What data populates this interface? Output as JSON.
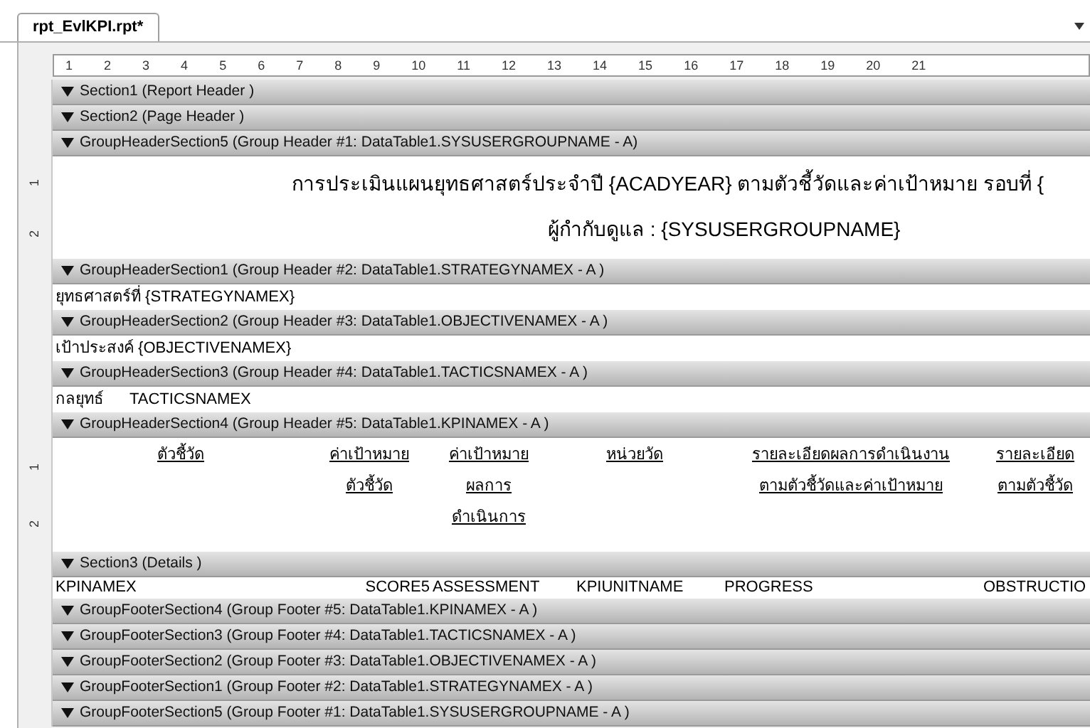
{
  "tab": {
    "label": "rpt_EvlKPI.rpt*",
    "selected": true
  },
  "ruler": {
    "marks": [
      "1",
      "2",
      "3",
      "4",
      "5",
      "6",
      "7",
      "8",
      "9",
      "10",
      "11",
      "12",
      "13",
      "14",
      "15",
      "16",
      "17",
      "18",
      "19",
      "20",
      "21"
    ]
  },
  "sections": [
    {
      "name": "Section1 (Report Header )",
      "expanded": true
    },
    {
      "name": "Section2 (Page Header )",
      "expanded": true
    },
    {
      "name": "GroupHeaderSection5 (Group Header #1: DataTable1.SYSUSERGROUPNAME - A)",
      "expanded": true,
      "body": {
        "kind": "title",
        "ruler_labels": [
          "1",
          "2"
        ],
        "lines": [
          "การประเมินแผนยุทธศาสตร์ประจำปี {ACADYEAR} ตามตัวชี้วัดและค่าเป้าหมาย รอบที่ {",
          "ผู้กำกับดูแล : {SYSUSERGROUPNAME}"
        ]
      }
    },
    {
      "name": "GroupHeaderSection1 (Group Header #2: DataTable1.STRATEGYNAMEX - A )",
      "expanded": true,
      "body": {
        "kind": "text_row",
        "items": [
          "ยุทธศาสตร์ที่ {STRATEGYNAMEX}"
        ]
      }
    },
    {
      "name": "GroupHeaderSection2 (Group Header #3: DataTable1.OBJECTIVENAMEX - A )",
      "expanded": true,
      "body": {
        "kind": "text_row",
        "items": [
          "เป้าประสงค์ {OBJECTIVENAMEX}"
        ]
      }
    },
    {
      "name": "GroupHeaderSection3 (Group Header #4: DataTable1.TACTICSNAMEX - A )",
      "expanded": true,
      "body": {
        "kind": "text_row",
        "items": [
          "กลยุทธ์",
          "TACTICSNAMEX"
        ]
      }
    },
    {
      "name": "GroupHeaderSection4 (Group Header #5: DataTable1.KPINAMEX - A )",
      "expanded": true,
      "body": {
        "kind": "column_headers",
        "ruler_labels": [
          "1",
          "2"
        ],
        "columns": [
          {
            "lines": [
              "ตัวชี้วัด"
            ]
          },
          {
            "lines": [
              "ค่าเป้าหมาย",
              "ตัวชี้วัด"
            ]
          },
          {
            "lines": [
              "ค่าเป้าหมาย",
              "ผลการ",
              "ดำเนินการ"
            ]
          },
          {
            "lines": [
              "หน่วยวัด"
            ]
          },
          {
            "lines": [
              "รายละเอียดผลการดำเนินงาน",
              "ตามตัวชี้วัดและค่าเป้าหมาย"
            ]
          },
          {
            "lines": [
              "รายละเอียด",
              "ตามตัวชี้วัด"
            ]
          }
        ]
      }
    },
    {
      "name": "Section3 (Details )",
      "expanded": true,
      "body": {
        "kind": "fields",
        "items": [
          "KPINAMEX",
          "SCORE5",
          "ASSESSMENT",
          "KPIUNITNAME",
          "PROGRESS",
          "OBSTRUCTIO"
        ]
      }
    },
    {
      "name": "GroupFooterSection4 (Group Footer #5: DataTable1.KPINAMEX - A )",
      "expanded": true
    },
    {
      "name": "GroupFooterSection3 (Group Footer #4: DataTable1.TACTICSNAMEX - A )",
      "expanded": true
    },
    {
      "name": "GroupFooterSection2 (Group Footer #3: DataTable1.OBJECTIVENAMEX - A )",
      "expanded": true
    },
    {
      "name": "GroupFooterSection1 (Group Footer #2: DataTable1.STRATEGYNAMEX - A )",
      "expanded": true
    },
    {
      "name": "GroupFooterSection5 (Group Footer #1: DataTable1.SYSUSERGROUPNAME - A )",
      "expanded": true
    }
  ]
}
